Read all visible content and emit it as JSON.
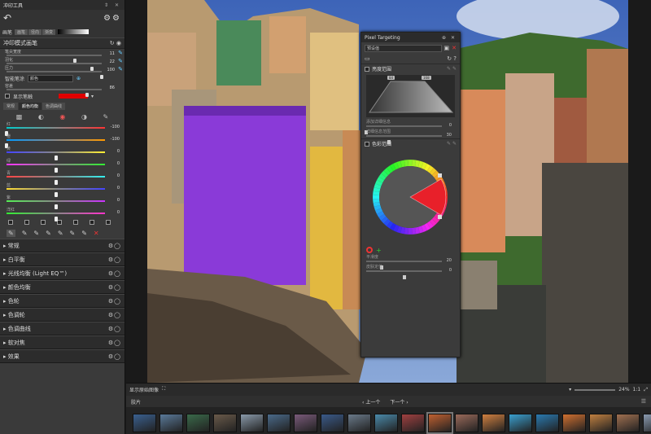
{
  "app": {
    "title": "冲印工具",
    "title_controls": "⇕ ✕",
    "tool_icons": "⚙⚙"
  },
  "brush_bar": {
    "label": "画笔",
    "tabs": [
      "画笔",
      "径向",
      "渐变"
    ]
  },
  "brush_panel": {
    "title": "冲印模式画笔",
    "sliders": [
      {
        "label": "笔尖宽度",
        "value": "11",
        "pos": 0.72
      },
      {
        "label": "羽化",
        "value": "22",
        "pos": 0.9
      },
      {
        "label": "压力",
        "value": "100",
        "pos": 1.0
      }
    ],
    "mode_label": "智能笔涂",
    "mode_value": "颜色",
    "strength_label": "容差",
    "strength_value": "86",
    "strength_pos": 0.85,
    "show_brush_label": "显示笔触",
    "brush_color": "#e00000"
  },
  "subtabs": [
    "常规",
    "颜色均衡",
    "色调曲线"
  ],
  "color_sliders": [
    {
      "label": "红",
      "value": "-100",
      "pos": 0.0,
      "gradient": "linear-gradient(90deg,#0cc,#888,#f33)"
    },
    {
      "label": "橙",
      "value": "-100",
      "pos": 0.0,
      "gradient": "linear-gradient(90deg,#09f,#888,#f90)"
    },
    {
      "label": "黄",
      "value": "0",
      "pos": 0.5,
      "gradient": "linear-gradient(90deg,#44f,#888,#fe3)"
    },
    {
      "label": "绿",
      "value": "0",
      "pos": 0.5,
      "gradient": "linear-gradient(90deg,#f3f,#888,#3e3)"
    },
    {
      "label": "青",
      "value": "0",
      "pos": 0.5,
      "gradient": "linear-gradient(90deg,#f44,#888,#3ee)"
    },
    {
      "label": "蓝",
      "value": "0",
      "pos": 0.5,
      "gradient": "linear-gradient(90deg,#fd3,#888,#44f)"
    },
    {
      "label": "紫",
      "value": "0",
      "pos": 0.5,
      "gradient": "linear-gradient(90deg,#5e5,#888,#c3f)"
    },
    {
      "label": "洋红",
      "value": "0",
      "pos": 0.5,
      "gradient": "linear-gradient(90deg,#3e3,#888,#f3c)"
    }
  ],
  "accordion": [
    "常规",
    "白平衡",
    "光线均衡 (Light EQ™)",
    "颜色均衡",
    "色轮",
    "色调轮",
    "色调曲线",
    "软对焦",
    "效果"
  ],
  "pixel_targeting": {
    "title": "Pixel Targeting",
    "preset": "预设值",
    "luminance_section": "亮度范围",
    "badges": [
      "84",
      "168"
    ],
    "lum_sliders": [
      {
        "label": "添加详细信息",
        "value": "0",
        "pos": 0.0
      },
      {
        "label": "详细信息范围",
        "value": "30",
        "pos": 0.3
      }
    ],
    "color_section": "色彩范围",
    "smooth_sliders": [
      {
        "label": "平滑度",
        "value": "20",
        "pos": 0.2
      },
      {
        "label": "皮肤定位",
        "value": "0",
        "pos": 0.5
      }
    ]
  },
  "bottom_bar": {
    "show_original": "显示原始图像",
    "zoom": "24%",
    "ratio": "1:1"
  },
  "filmstrip": {
    "tab": "胶片",
    "prev": "上一个",
    "next": "下一个",
    "thumbs": [
      "#3a6090",
      "#5a7a9a",
      "#3a6a4a",
      "#6a5a4a",
      "#8a9aaa",
      "#4a6a8a",
      "#7a5a7a",
      "#3a5a8a",
      "#6a7a8a",
      "#4a8aaa",
      "#a04040",
      "#c06030",
      "#9a6a5a",
      "#d08040",
      "#3aa0d0",
      "#2a7ab0",
      "#d07030",
      "#c08040",
      "#a07050",
      "#8a9ab0",
      "#5a6a8a",
      "#6a8aaa",
      "#4a5a6a",
      "#2a3a5a"
    ],
    "selected_index": 11
  }
}
